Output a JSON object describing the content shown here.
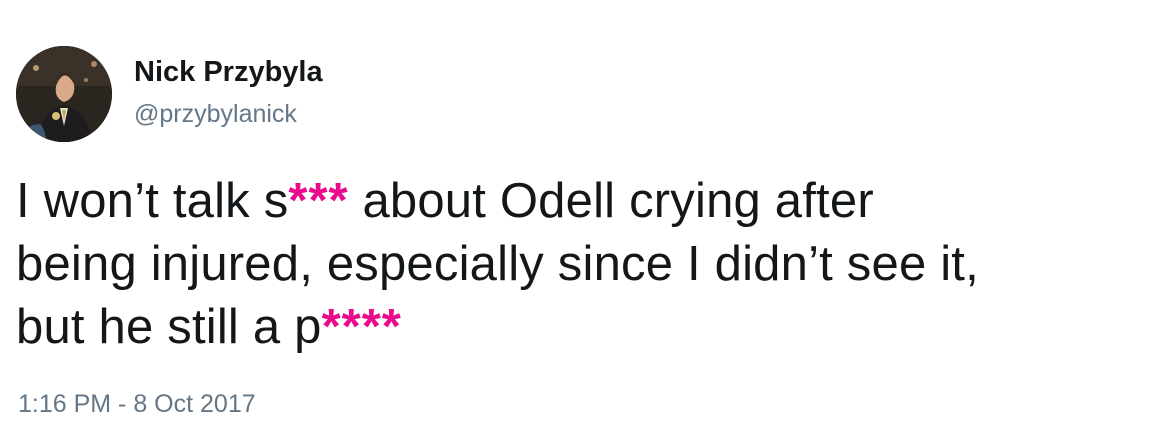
{
  "user": {
    "display_name": "Nick Przybyla",
    "handle": "@przybylanick"
  },
  "tweet": {
    "line1_before": "I won’t talk s",
    "line1_censor": "***",
    "line1_after": " about Odell crying after",
    "line2": "being injured, especially since I didn’t see it,",
    "line3_before": "but he still a p",
    "line3_censor": "****",
    "timestamp": "1:16 PM - 8 Oct 2017"
  },
  "colors": {
    "text": "#14171a",
    "secondary": "#657786",
    "censor": "#ea0a8e"
  }
}
